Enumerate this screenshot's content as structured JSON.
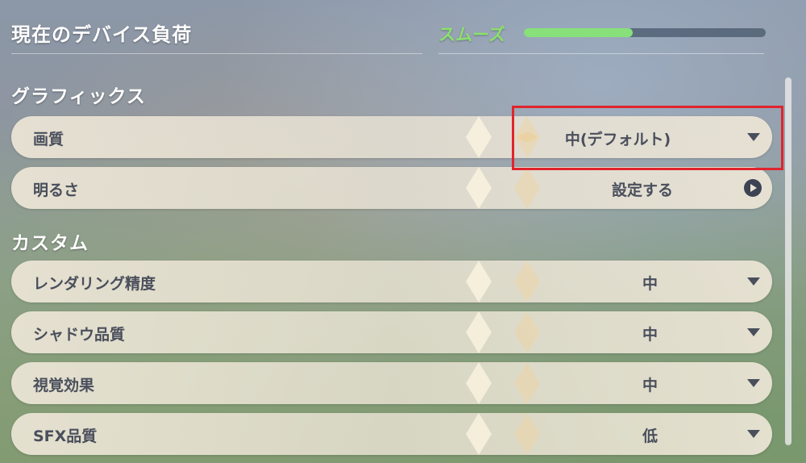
{
  "header": {
    "title": "現在のデバイス負荷",
    "load_status": "スムーズ",
    "load_level": 0.45
  },
  "sections": [
    {
      "title": "グラフィックス",
      "rows": [
        {
          "label": "画質",
          "value": "中(デフォルト)",
          "control": "dropdown"
        },
        {
          "label": "明るさ",
          "value": "設定する",
          "control": "link"
        }
      ]
    },
    {
      "title": "カスタム",
      "rows": [
        {
          "label": "レンダリング精度",
          "value": "中",
          "control": "dropdown"
        },
        {
          "label": "シャドウ品質",
          "value": "中",
          "control": "dropdown"
        },
        {
          "label": "視覚効果",
          "value": "中",
          "control": "dropdown"
        },
        {
          "label": "SFX品質",
          "value": "低",
          "control": "dropdown"
        }
      ]
    }
  ],
  "icons": {
    "dropdown": "caret-down-icon",
    "link": "play-circle-icon"
  },
  "colors": {
    "load_status": "#8be06e",
    "load_fill": "#88e07a",
    "highlight": "#e0242c",
    "row_text": "#4a4f5c"
  }
}
